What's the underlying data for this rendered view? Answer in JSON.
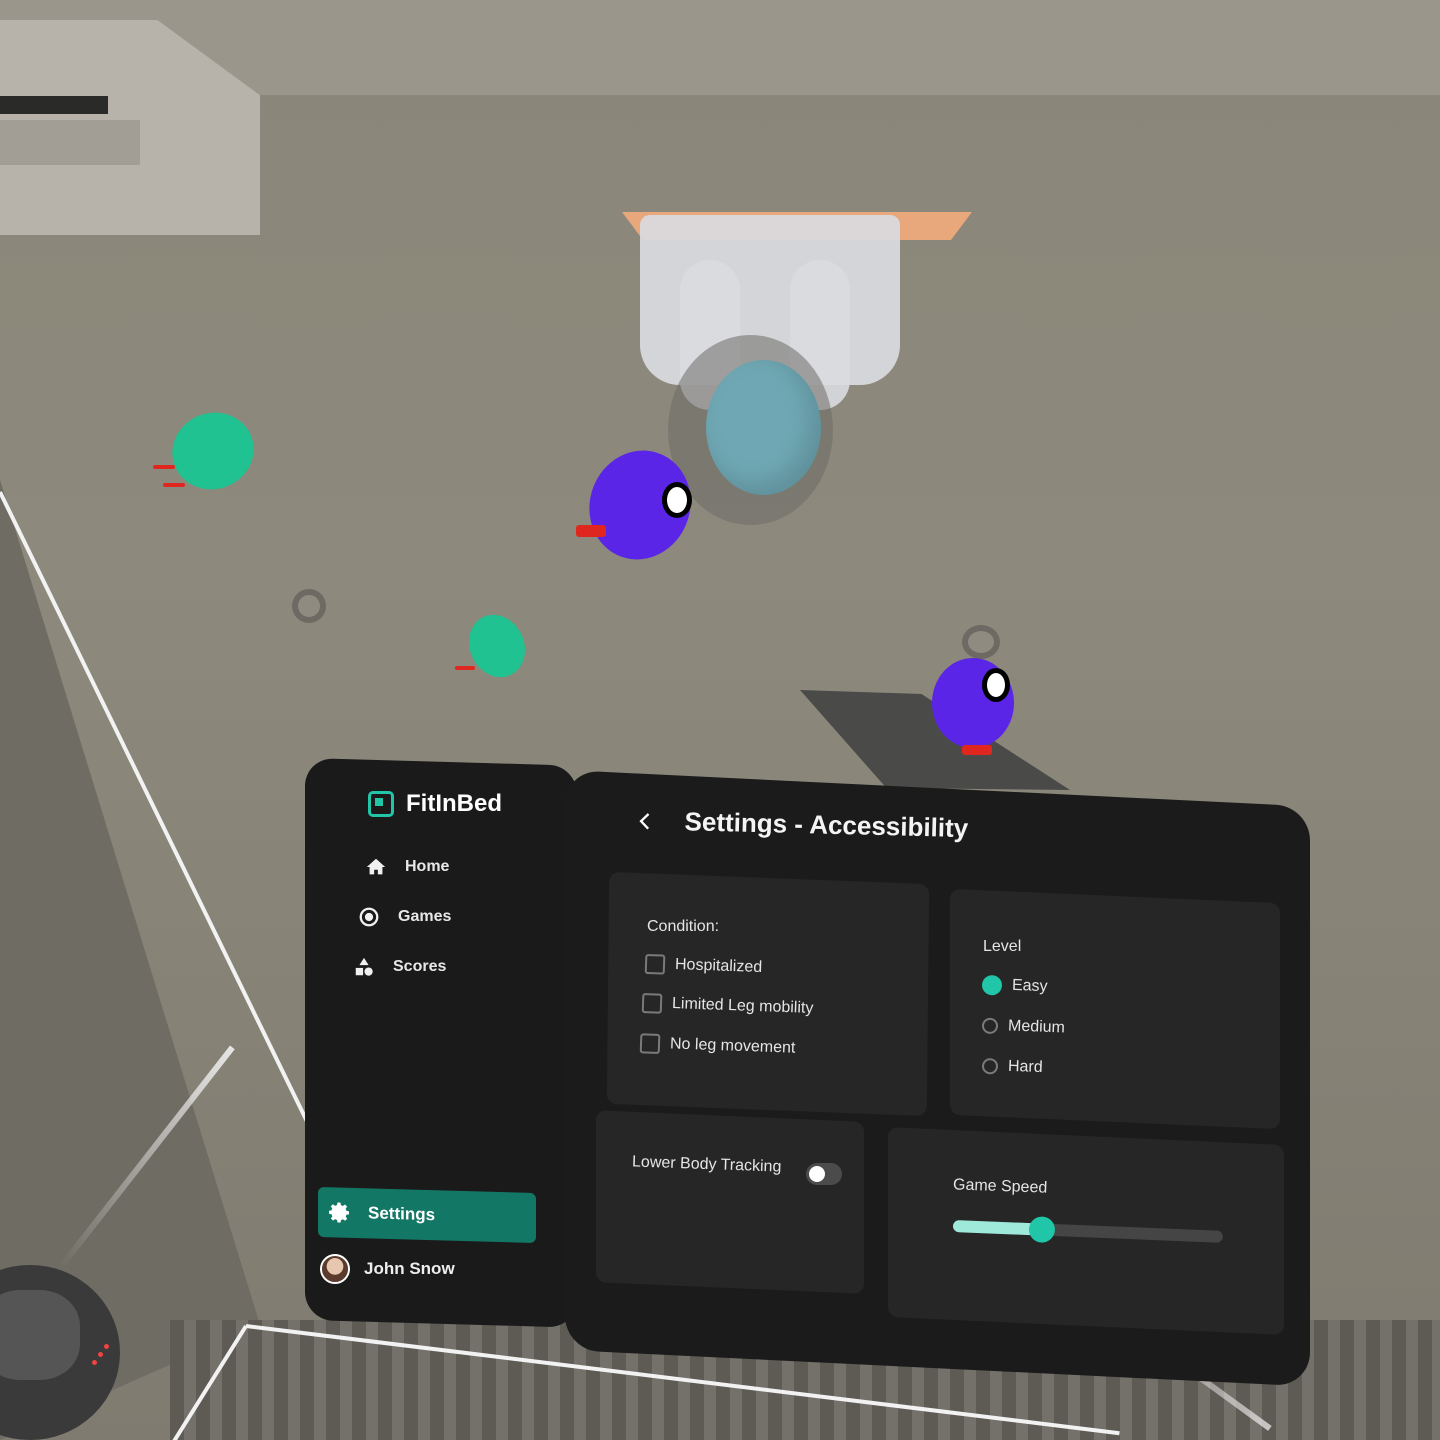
{
  "app": {
    "name": "FitInBed"
  },
  "sidebar": {
    "items": [
      {
        "label": "Home",
        "icon": "home-icon"
      },
      {
        "label": "Games",
        "icon": "target-icon"
      },
      {
        "label": "Scores",
        "icon": "shapes-icon"
      }
    ],
    "settings": {
      "label": "Settings",
      "icon": "gear-icon"
    },
    "user": {
      "name": "John Snow"
    }
  },
  "page": {
    "title": "Settings - Accessibility",
    "back_icon": "chevron-left-icon"
  },
  "condition": {
    "label": "Condition:",
    "options": [
      {
        "label": "Hospitalized",
        "checked": false
      },
      {
        "label": "Limited Leg mobility",
        "checked": false
      },
      {
        "label": "No leg movement",
        "checked": false
      }
    ]
  },
  "level": {
    "label": "Level",
    "options": [
      {
        "label": "Easy",
        "selected": true
      },
      {
        "label": "Medium",
        "selected": false
      },
      {
        "label": "Hard",
        "selected": false
      }
    ]
  },
  "lower_body": {
    "label": "Lower Body Tracking",
    "on": false
  },
  "game_speed": {
    "label": "Game Speed",
    "value": 0.33
  },
  "colors": {
    "accent": "#21c5a8",
    "active_nav": "#137766",
    "panel": "#1a1a1a",
    "card": "#262626"
  }
}
